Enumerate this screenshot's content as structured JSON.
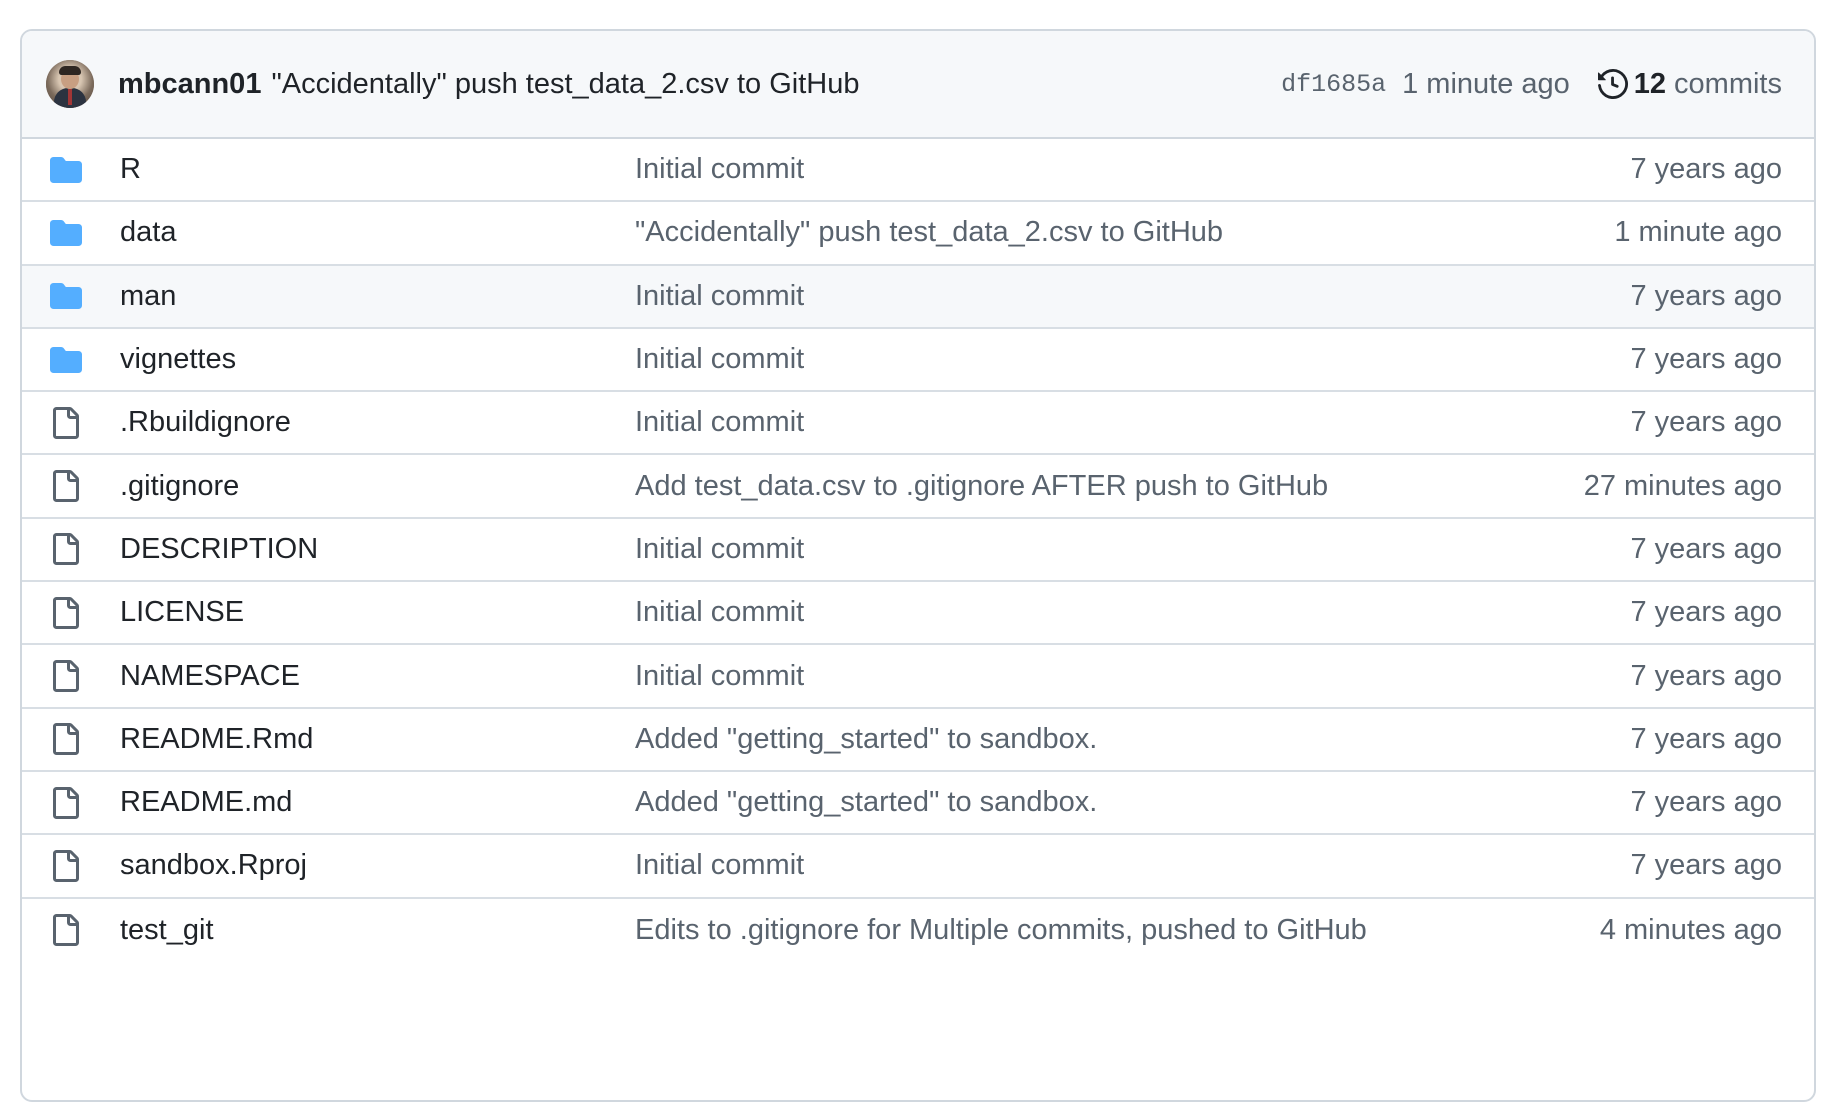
{
  "latest_commit": {
    "author": "mbcann01",
    "message": "\"Accidentally\" push test_data_2.csv to GitHub",
    "sha": "df1685a",
    "time": "1 minute ago",
    "commit_count": "12",
    "commit_label": "commits"
  },
  "colors": {
    "folder": "#54aeff",
    "file_icon": "#59636e",
    "muted_text": "#59636e",
    "border": "#d0d7de",
    "header_bg": "#f6f8fa"
  },
  "files": [
    {
      "type": "folder",
      "icon": "folder-icon",
      "name": "R",
      "message": "Initial commit",
      "age": "7 years ago"
    },
    {
      "type": "folder",
      "icon": "folder-icon",
      "name": "data",
      "message": "\"Accidentally\" push test_data_2.csv to GitHub",
      "age": "1 minute ago"
    },
    {
      "type": "folder",
      "icon": "folder-icon",
      "name": "man",
      "message": "Initial commit",
      "age": "7 years ago"
    },
    {
      "type": "folder",
      "icon": "folder-icon",
      "name": "vignettes",
      "message": "Initial commit",
      "age": "7 years ago"
    },
    {
      "type": "file",
      "icon": "file-icon",
      "name": ".Rbuildignore",
      "message": "Initial commit",
      "age": "7 years ago"
    },
    {
      "type": "file",
      "icon": "file-icon",
      "name": ".gitignore",
      "message": "Add test_data.csv to .gitignore AFTER push to GitHub",
      "age": "27 minutes ago"
    },
    {
      "type": "file",
      "icon": "file-icon",
      "name": "DESCRIPTION",
      "message": "Initial commit",
      "age": "7 years ago"
    },
    {
      "type": "file",
      "icon": "file-icon",
      "name": "LICENSE",
      "message": "Initial commit",
      "age": "7 years ago"
    },
    {
      "type": "file",
      "icon": "file-icon",
      "name": "NAMESPACE",
      "message": "Initial commit",
      "age": "7 years ago"
    },
    {
      "type": "file",
      "icon": "file-icon",
      "name": "README.Rmd",
      "message": "Added \"getting_started\" to sandbox.",
      "age": "7 years ago"
    },
    {
      "type": "file",
      "icon": "file-icon",
      "name": "README.md",
      "message": "Added \"getting_started\" to sandbox.",
      "age": "7 years ago"
    },
    {
      "type": "file",
      "icon": "file-icon",
      "name": "sandbox.Rproj",
      "message": "Initial commit",
      "age": "7 years ago"
    },
    {
      "type": "file",
      "icon": "file-icon",
      "name": "test_git",
      "message": "Edits to .gitignore for Multiple commits, pushed to GitHub",
      "age": "4 minutes ago"
    }
  ]
}
